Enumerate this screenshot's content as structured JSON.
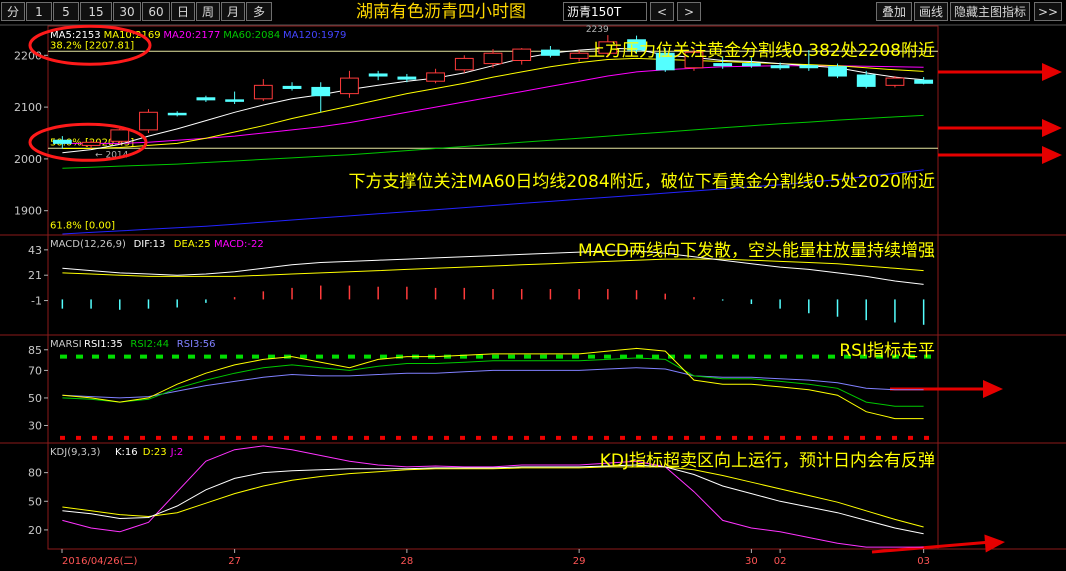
{
  "toolbar": {
    "period_buttons": [
      "分",
      "1",
      "5",
      "15",
      "30",
      "60",
      "日",
      "周",
      "月",
      "多"
    ],
    "title": "湖南有色沥青四小时图",
    "symbol": "沥青150T",
    "right_buttons": [
      "叠加",
      "画线",
      "隐藏主图指标",
      ">>"
    ],
    "nav_prev": "<",
    "nav_next": ">"
  },
  "colors": {
    "bg": "#000000",
    "frame": "#8b1a1a",
    "up": "#ff3b3b",
    "down": "#54ffff",
    "annotation": "#ffff00",
    "arrow": "#e60000",
    "ma5": "#ffffff",
    "ma10": "#ffff00",
    "ma20": "#ff00ff",
    "ma60": "#00c800",
    "ma120": "#2323ff",
    "rsi_high_line": "#00dd00",
    "rsi_low_line": "#ee0000",
    "j_line": "#ff33ff"
  },
  "main": {
    "legend": [
      {
        "text": "MA5:2153",
        "color": "#ffffff"
      },
      {
        "text": "MA10:2169",
        "color": "#ffff00"
      },
      {
        "text": "MA20:2177",
        "color": "#ff00ff"
      },
      {
        "text": "MA60:2084",
        "color": "#00c800"
      },
      {
        "text": "MA120:1979",
        "color": "#4444ff"
      }
    ],
    "fib_labels": [
      {
        "text": "38.2% [2207.81]",
        "price": 2207.81,
        "color": "#ffff00"
      },
      {
        "text": "50.0% [2020.45]",
        "price": 2020.45,
        "color": "#ffff00"
      },
      {
        "text": "61.8% [0.00]",
        "price": 1860,
        "color": "#ffff00"
      }
    ],
    "y_ticks": [
      "2200",
      "2100",
      "2000",
      "1900"
    ],
    "y_tick_values": [
      2200,
      2100,
      2000,
      1900
    ],
    "price_range": [
      1855,
      2245
    ],
    "high_marker": "2239",
    "low_marker": "2014",
    "annotation_top": "上方压力位关注黄金分割线0.382处2208附近",
    "annotation_bottom": "下方支撑位关注MA60日均线2084附近，破位下看黄金分割线0.5处2020附近"
  },
  "macd": {
    "legend": [
      {
        "text": "MACD(12,26,9)",
        "color": "#c8c8c8"
      },
      {
        "text": "DIF:13",
        "color": "#ffffff"
      },
      {
        "text": "DEA:25",
        "color": "#ffff00"
      },
      {
        "text": "MACD:-22",
        "color": "#ff00ff"
      }
    ],
    "y_ticks": [
      "43",
      "21",
      "-1"
    ],
    "y_tick_values": [
      43,
      21,
      -1
    ],
    "range": [
      -30,
      55
    ],
    "annotation": "MACD两线向下发散，空头能量柱放量持续增强"
  },
  "rsi": {
    "legend": [
      {
        "text": "MARSI",
        "color": "#c8c8c8"
      },
      {
        "text": "RSI1:35",
        "color": "#ffffff"
      },
      {
        "text": "RSI2:44",
        "color": "#00c800"
      },
      {
        "text": "RSI3:56",
        "color": "#8080ff"
      }
    ],
    "y_ticks": [
      "85",
      "70",
      "50",
      "30"
    ],
    "y_tick_values": [
      85,
      70,
      50,
      30
    ],
    "range": [
      18,
      95
    ],
    "annotation": "RSI指标走平"
  },
  "kdj": {
    "legend": [
      {
        "text": "KDJ(9,3,3)",
        "color": "#c8c8c8"
      },
      {
        "text": "K:16",
        "color": "#ffffff"
      },
      {
        "text": "D:23",
        "color": "#ffff00"
      },
      {
        "text": "J:2",
        "color": "#ff00ff"
      }
    ],
    "y_ticks": [
      "80",
      "50",
      "20"
    ],
    "y_tick_values": [
      80,
      50,
      20
    ],
    "range": [
      0,
      110
    ],
    "annotation": "KDJ指标超卖区向上运行，预计日内会有反弹"
  },
  "x_axis": {
    "labels": [
      "2016/04/26(二)",
      "27",
      "28",
      "29",
      "30",
      "02",
      "03"
    ],
    "label_bars": [
      0,
      6,
      12,
      18,
      24,
      25,
      30
    ]
  },
  "chart_data": [
    {
      "type": "candlestick",
      "title": "湖南有色沥青四小时图",
      "candles": [
        {
          "o": 2036,
          "h": 2044,
          "l": 2020,
          "c": 2030
        },
        {
          "o": 2026,
          "h": 2036,
          "l": 2020,
          "c": 2032
        },
        {
          "o": 2034,
          "h": 2060,
          "l": 2028,
          "c": 2056
        },
        {
          "o": 2056,
          "h": 2096,
          "l": 2050,
          "c": 2090
        },
        {
          "o": 2088,
          "h": 2092,
          "l": 2082,
          "c": 2086
        },
        {
          "o": 2118,
          "h": 2122,
          "l": 2110,
          "c": 2114
        },
        {
          "o": 2114,
          "h": 2130,
          "l": 2106,
          "c": 2112
        },
        {
          "o": 2116,
          "h": 2154,
          "l": 2112,
          "c": 2142
        },
        {
          "o": 2140,
          "h": 2148,
          "l": 2132,
          "c": 2136
        },
        {
          "o": 2138,
          "h": 2148,
          "l": 2090,
          "c": 2122
        },
        {
          "o": 2126,
          "h": 2170,
          "l": 2118,
          "c": 2156
        },
        {
          "o": 2164,
          "h": 2170,
          "l": 2152,
          "c": 2160
        },
        {
          "o": 2158,
          "h": 2164,
          "l": 2148,
          "c": 2154
        },
        {
          "o": 2150,
          "h": 2174,
          "l": 2146,
          "c": 2166
        },
        {
          "o": 2172,
          "h": 2200,
          "l": 2166,
          "c": 2194
        },
        {
          "o": 2184,
          "h": 2212,
          "l": 2176,
          "c": 2204
        },
        {
          "o": 2190,
          "h": 2214,
          "l": 2182,
          "c": 2212
        },
        {
          "o": 2210,
          "h": 2218,
          "l": 2196,
          "c": 2200
        },
        {
          "o": 2194,
          "h": 2210,
          "l": 2188,
          "c": 2204
        },
        {
          "o": 2204,
          "h": 2239,
          "l": 2196,
          "c": 2226
        },
        {
          "o": 2230,
          "h": 2238,
          "l": 2204,
          "c": 2210
        },
        {
          "o": 2204,
          "h": 2214,
          "l": 2168,
          "c": 2172
        },
        {
          "o": 2176,
          "h": 2212,
          "l": 2170,
          "c": 2206
        },
        {
          "o": 2184,
          "h": 2198,
          "l": 2174,
          "c": 2180
        },
        {
          "o": 2184,
          "h": 2196,
          "l": 2176,
          "c": 2180
        },
        {
          "o": 2180,
          "h": 2186,
          "l": 2172,
          "c": 2176
        },
        {
          "o": 2180,
          "h": 2210,
          "l": 2170,
          "c": 2176
        },
        {
          "o": 2178,
          "h": 2184,
          "l": 2156,
          "c": 2160
        },
        {
          "o": 2162,
          "h": 2170,
          "l": 2136,
          "c": 2140
        },
        {
          "o": 2142,
          "h": 2160,
          "l": 2138,
          "c": 2156
        },
        {
          "o": 2152,
          "h": 2158,
          "l": 2144,
          "c": 2146
        }
      ],
      "ma5": [
        2012,
        2018,
        2028,
        2044,
        2058,
        2074,
        2090,
        2104,
        2116,
        2124,
        2134,
        2142,
        2150,
        2156,
        2166,
        2180,
        2194,
        2204,
        2210,
        2214,
        2212,
        2200,
        2196,
        2190,
        2188,
        2184,
        2180,
        2176,
        2166,
        2158,
        2153
      ],
      "ma10": [
        2020,
        2020,
        2022,
        2026,
        2030,
        2040,
        2052,
        2064,
        2078,
        2090,
        2102,
        2114,
        2126,
        2136,
        2146,
        2158,
        2168,
        2178,
        2186,
        2192,
        2194,
        2192,
        2190,
        2188,
        2186,
        2184,
        2182,
        2180,
        2176,
        2172,
        2169
      ],
      "ma20": [
        2030,
        2030,
        2030,
        2032,
        2036,
        2040,
        2044,
        2050,
        2056,
        2062,
        2070,
        2080,
        2090,
        2100,
        2110,
        2120,
        2130,
        2140,
        2150,
        2160,
        2168,
        2172,
        2175,
        2178,
        2179,
        2180,
        2180,
        2180,
        2179,
        2178,
        2177
      ],
      "ma60": [
        1982,
        1984,
        1986,
        1988,
        1990,
        1993,
        1996,
        1999,
        2002,
        2005,
        2008,
        2012,
        2016,
        2020,
        2024,
        2028,
        2032,
        2036,
        2040,
        2044,
        2048,
        2052,
        2056,
        2060,
        2064,
        2068,
        2071,
        2075,
        2078,
        2081,
        2084
      ],
      "ma120": [
        1855,
        1858,
        1861,
        1864,
        1867,
        1870,
        1874,
        1878,
        1882,
        1886,
        1890,
        1894,
        1898,
        1902,
        1906,
        1910,
        1914,
        1918,
        1922,
        1926,
        1930,
        1934,
        1938,
        1942,
        1946,
        1950,
        1955,
        1960,
        1966,
        1972,
        1979
      ]
    },
    {
      "type": "line",
      "title": "MACD(12,26,9)",
      "dif": [
        27,
        25,
        23,
        22,
        21,
        22,
        24,
        27,
        30,
        32,
        33,
        34,
        35,
        36,
        37,
        38,
        39,
        40,
        41,
        42,
        42,
        40,
        37,
        34,
        31,
        28,
        26,
        23,
        20,
        16,
        13
      ],
      "dea": [
        23,
        22,
        21,
        20,
        20,
        20,
        20,
        21,
        22,
        23,
        24,
        25,
        26,
        27,
        28,
        29,
        30,
        31,
        32,
        33,
        34,
        35,
        35,
        35,
        34,
        33,
        32,
        31,
        29,
        27,
        25
      ],
      "macd": [
        -8,
        -8,
        -9,
        -8,
        -7,
        -3,
        2,
        7,
        10,
        12,
        12,
        11,
        11,
        10,
        10,
        9,
        9,
        9,
        9,
        9,
        8,
        5,
        2,
        -1,
        -4,
        -8,
        -12,
        -15,
        -18,
        -20,
        -22
      ]
    },
    {
      "type": "line",
      "title": "MARSI",
      "rsi1": [
        52,
        50,
        47,
        50,
        60,
        68,
        74,
        78,
        80,
        76,
        72,
        78,
        80,
        80,
        81,
        82,
        82,
        82,
        82,
        84,
        86,
        84,
        63,
        60,
        60,
        58,
        56,
        52,
        40,
        35,
        35
      ],
      "rsi2": [
        50,
        49,
        47,
        49,
        57,
        63,
        68,
        72,
        74,
        72,
        70,
        73,
        75,
        75,
        76,
        77,
        77,
        77,
        77,
        78,
        79,
        78,
        66,
        64,
        64,
        62,
        60,
        57,
        47,
        44,
        44
      ],
      "rsi3": [
        52,
        51,
        50,
        51,
        55,
        59,
        62,
        65,
        67,
        66,
        66,
        67,
        68,
        68,
        69,
        70,
        70,
        70,
        70,
        71,
        72,
        71,
        66,
        65,
        65,
        64,
        63,
        61,
        57,
        56,
        56
      ],
      "upper_line": 80,
      "lower_line": 21
    },
    {
      "type": "line",
      "title": "KDJ(9,3,3)",
      "k": [
        40,
        37,
        32,
        33,
        45,
        62,
        74,
        80,
        82,
        83,
        84,
        84,
        84,
        85,
        85,
        85,
        86,
        86,
        86,
        87,
        88,
        86,
        78,
        66,
        58,
        50,
        44,
        38,
        30,
        22,
        16
      ],
      "d": [
        44,
        40,
        36,
        34,
        38,
        48,
        58,
        66,
        72,
        76,
        79,
        81,
        83,
        84,
        84,
        84,
        85,
        85,
        85,
        86,
        86,
        86,
        83,
        77,
        70,
        63,
        56,
        49,
        40,
        31,
        23
      ],
      "j": [
        30,
        22,
        18,
        28,
        60,
        92,
        104,
        108,
        104,
        98,
        92,
        88,
        86,
        87,
        86,
        86,
        88,
        88,
        88,
        90,
        92,
        86,
        60,
        30,
        22,
        18,
        12,
        6,
        2,
        2,
        2
      ]
    }
  ]
}
